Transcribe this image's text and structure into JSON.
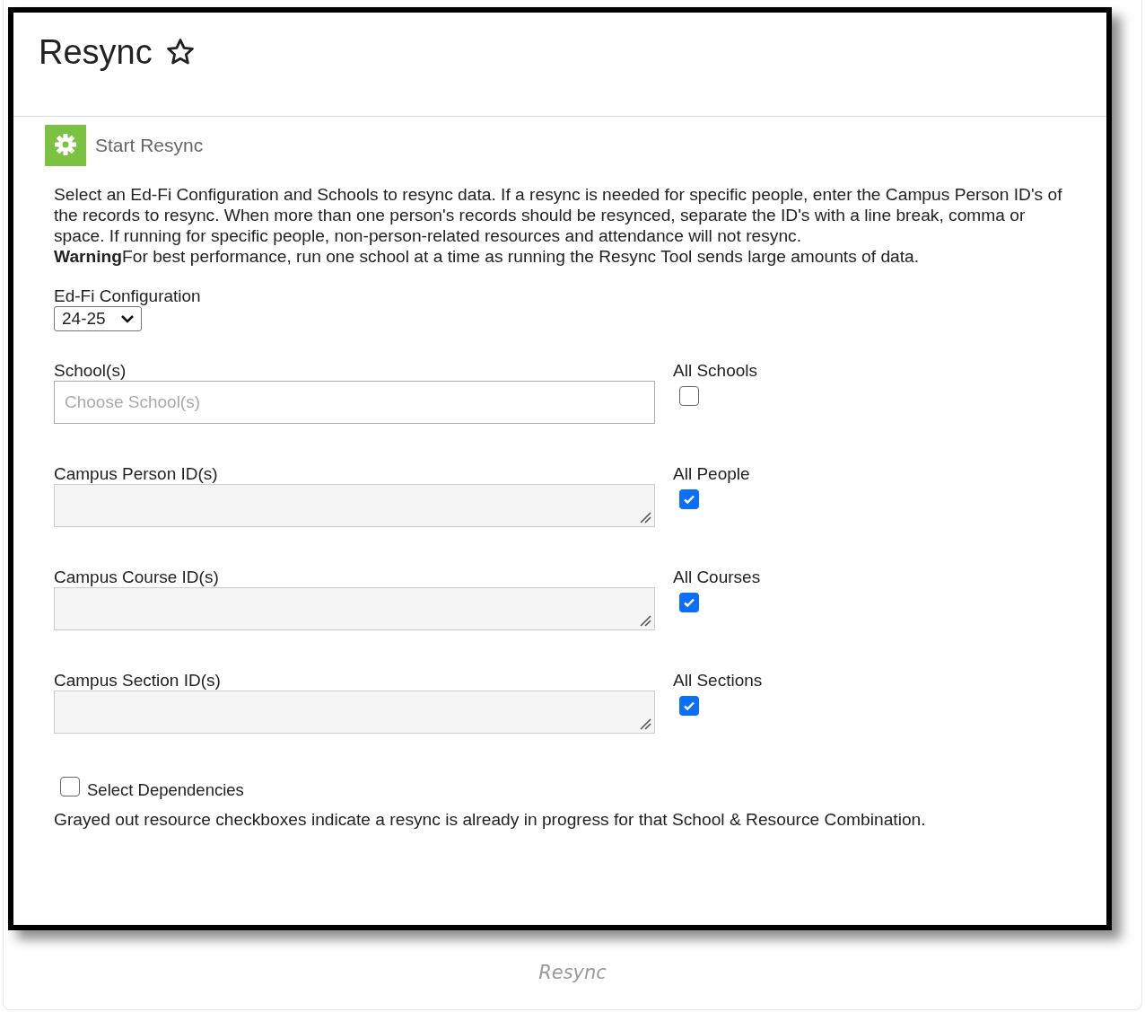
{
  "page": {
    "title": "Resync"
  },
  "section": {
    "title": "Start Resync"
  },
  "description": "Select an Ed-Fi Configuration and Schools to resync data. If a resync is needed for specific people, enter the Campus Person ID's of the records to resync. When more than one person's records should be resynced, separate the ID's with a line break, comma or space. If running for specific people, non-person-related resources and attendance will not resync.",
  "warning": "**Warning**For best performance, run one school at a time as running the Resync Tool sends large amounts of data.",
  "config": {
    "label": "Ed-Fi Configuration",
    "value": "24-25"
  },
  "rows": [
    {
      "kind": "select",
      "label": "School(s)",
      "placeholder": "Choose School(s)",
      "check_label": "All Schools",
      "checked": false
    },
    {
      "kind": "textarea",
      "label": "Campus Person ID(s)",
      "check_label": "All People",
      "checked": true
    },
    {
      "kind": "textarea",
      "label": "Campus Course ID(s)",
      "check_label": "All Courses",
      "checked": true
    },
    {
      "kind": "textarea",
      "label": "Campus Section ID(s)",
      "check_label": "All Sections",
      "checked": true
    }
  ],
  "dependencies": {
    "label": "Select Dependencies",
    "checked": false
  },
  "note": "Grayed out resource checkboxes indicate a resync is already in progress for that School & Resource Combination.",
  "caption": "Resync"
}
